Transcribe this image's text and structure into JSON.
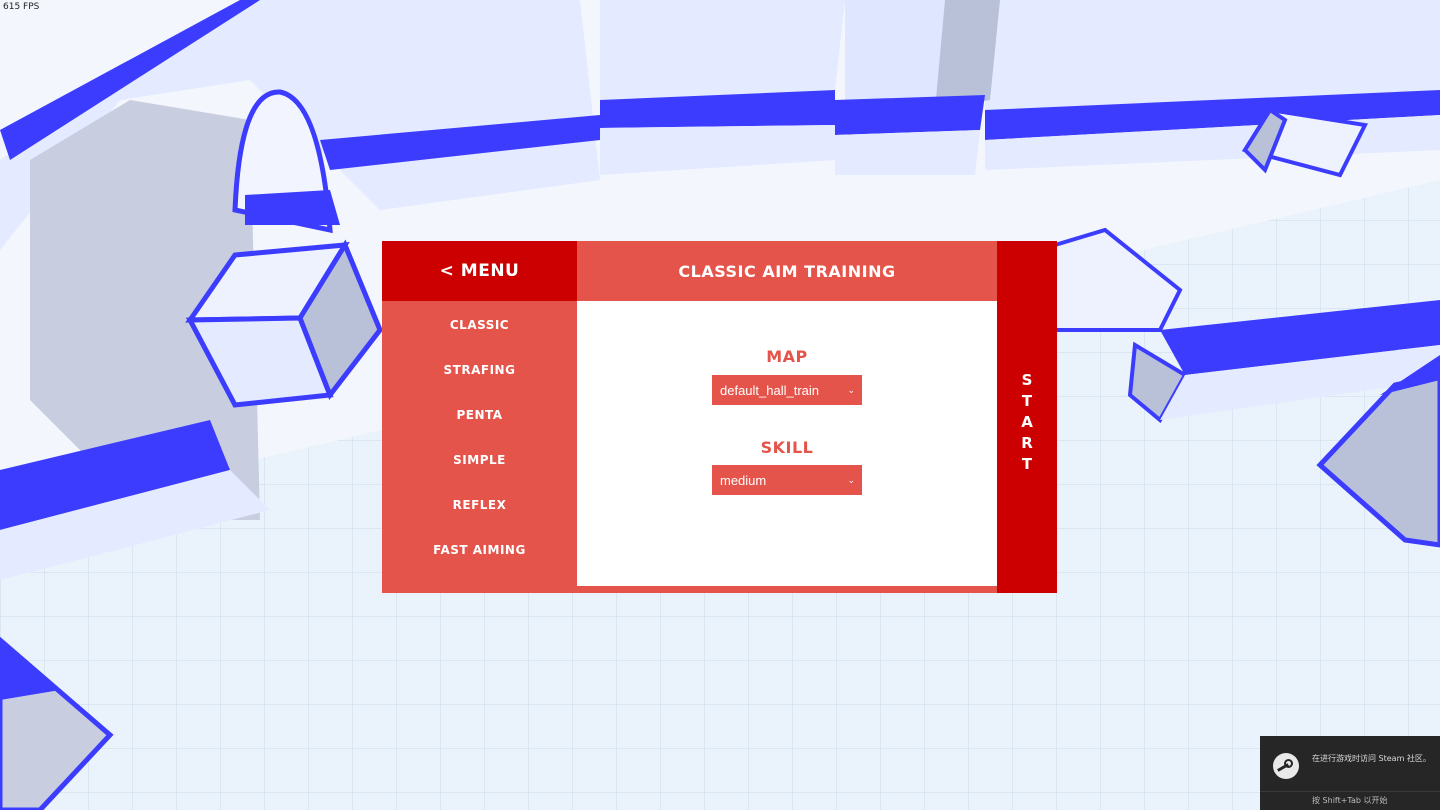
{
  "hud": {
    "fps": "615 FPS"
  },
  "menu": {
    "back_label": "< MENU",
    "title": "CLASSIC AIM TRAINING",
    "modes": [
      "CLASSIC",
      "STRAFING",
      "PENTA",
      "SIMPLE",
      "REFLEX",
      "FAST AIMING"
    ],
    "map_label": "MAP",
    "map_value": "default_hall_train",
    "skill_label": "SKILL",
    "skill_value": "medium",
    "start_label": "START"
  },
  "steam_overlay": {
    "message": "在进行游戏时访问 Steam 社区。",
    "hint": "按 Shift+Tab 以开始"
  },
  "colors": {
    "primary_red": "#cc0000",
    "secondary_red": "#e5544a",
    "content_bg": "#ffffff",
    "arena_blue": "#3c3cff",
    "arena_surface": "#e9efff"
  },
  "icons": {
    "steam_overlay_logo": "steam-logo-icon",
    "select_chevron": "chevron-down-icon"
  }
}
